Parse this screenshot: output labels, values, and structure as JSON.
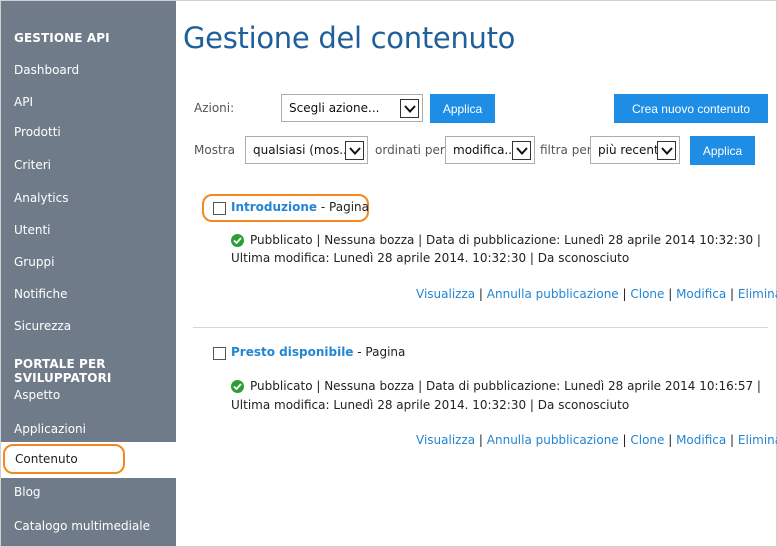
{
  "sidebar": {
    "section1_heading": "GESTIONE API",
    "section1_items": [
      "Dashboard",
      "API",
      "Prodotti",
      "Criteri",
      "Analytics",
      "Utenti",
      "Gruppi",
      "Notifiche",
      "Sicurezza"
    ],
    "section2_heading": "PORTALE PER SVILUPPATORI",
    "section2_items": [
      "Aspetto",
      "Applicazioni",
      "Contenuto",
      "Blog",
      "Catalogo multimediale"
    ],
    "active_item": "Contenuto"
  },
  "main": {
    "title": "Gestione del contenuto",
    "actions_label": "Azioni:",
    "actions_select": "Scegli azione...",
    "apply_label": "Applica",
    "create_label": "Crea nuovo contenuto",
    "filter": {
      "show_label": "Mostra",
      "show_value": "qualsiasi (mos...",
      "order_label": "ordinati per",
      "order_value": "modifica...",
      "filter_label": "filtra per",
      "filter_value": "più recenti",
      "apply_label": "Applica"
    },
    "items": [
      {
        "title": "Introduzione",
        "separator": " - ",
        "type": "Pagina",
        "line1": "Pubblicato | Nessuna bozza | Data di pubblicazione: Lunedì 28 aprile 2014 10:32:30 |",
        "line2": "Ultima modifica: Lunedì 28 aprile 2014. 10:32:30 | Da sconosciuto",
        "actions": [
          "Visualizza",
          "Annulla pubblicazione",
          "Clone",
          "Modifica",
          "Elimina"
        ]
      },
      {
        "title": "Presto disponibile",
        "separator": " - ",
        "type": "Pagina",
        "line1": "Pubblicato | Nessuna bozza | Data di pubblicazione: Lunedì 28 aprile 2014 10:16:57 |",
        "line2": "Ultima modifica: Lunedì 28 aprile 2014. 10:32:30 | Da sconosciuto",
        "actions": [
          "Visualizza",
          "Annulla pubblicazione",
          "Clone",
          "Modifica",
          "Elimina"
        ]
      }
    ],
    "action_separator": " | "
  },
  "colors": {
    "sidebar_bg": "#707b8a",
    "title": "#1f5f9a",
    "button": "#1e8de5",
    "link": "#2386d2",
    "highlight": "#f2881f",
    "status": "#2d9e36"
  }
}
